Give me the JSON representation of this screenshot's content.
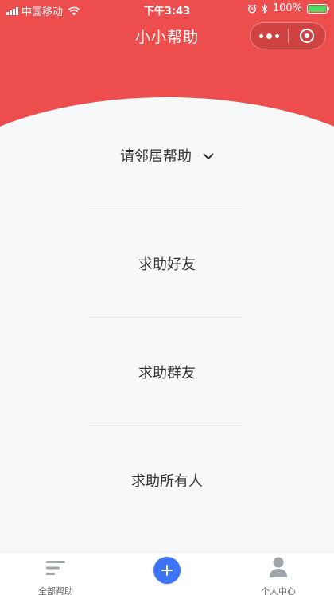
{
  "status_bar": {
    "carrier": "中国移动",
    "time": "下午3:43",
    "battery": "100%"
  },
  "nav": {
    "title": "小小帮助"
  },
  "options": [
    {
      "label": "请邻居帮助",
      "icon": "chevron-down-icon"
    },
    {
      "label": "求助好友"
    },
    {
      "label": "求助群友"
    },
    {
      "label": "求助所有人"
    }
  ],
  "tabbar": {
    "all_label": "全部帮助",
    "all_icon": "list-icon",
    "add_icon": "plus-icon",
    "me_label": "个人中心",
    "me_icon": "person-icon"
  },
  "colors": {
    "header": "#ee4d4d",
    "accent": "#3b74f6",
    "background": "#f7f8fa"
  }
}
